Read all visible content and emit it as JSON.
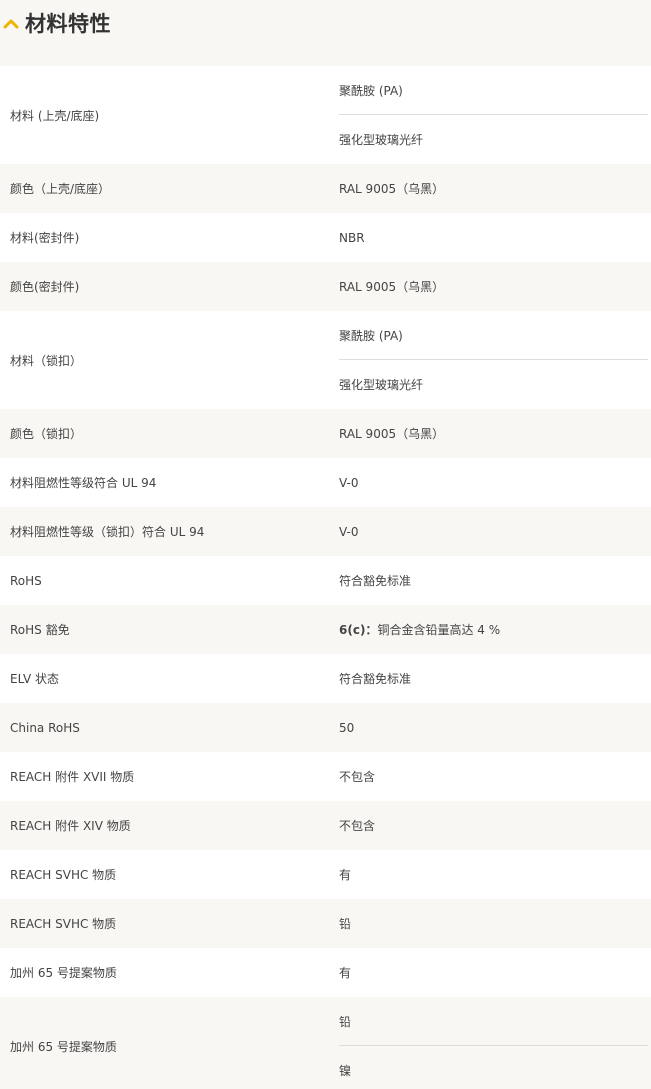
{
  "section": {
    "title": "材料特性",
    "toggle_icon": "chevron-up-icon",
    "accent_color": "#f0b400"
  },
  "rows": [
    {
      "label": "材料 (上壳/底座)",
      "values": [
        "聚酰胺 (PA)",
        "强化型玻璃光纤"
      ]
    },
    {
      "label": "颜色（上壳/底座）",
      "values": [
        "RAL 9005（乌黑）"
      ]
    },
    {
      "label": "材料(密封件)",
      "values": [
        "NBR"
      ]
    },
    {
      "label": "颜色(密封件)",
      "values": [
        "RAL 9005（乌黑）"
      ]
    },
    {
      "label": "材料（锁扣）",
      "values": [
        "聚酰胺 (PA)",
        "强化型玻璃光纤"
      ]
    },
    {
      "label": "颜色（锁扣）",
      "values": [
        "RAL 9005（乌黑）"
      ]
    },
    {
      "label": "材料阻燃性等级符合 UL 94",
      "values": [
        "V-0"
      ]
    },
    {
      "label": "材料阻燃性等级（锁扣）符合 UL 94",
      "values": [
        "V-0"
      ]
    },
    {
      "label": "RoHS",
      "values": [
        "符合豁免标准"
      ]
    },
    {
      "label": "RoHS 豁免",
      "values": [],
      "rich_value": {
        "bold": "6(c)：",
        "rest": "铜合金含铅量高达 4 %"
      }
    },
    {
      "label": "ELV 状态",
      "values": [
        "符合豁免标准"
      ]
    },
    {
      "label": "China RoHS",
      "values": [
        "50"
      ]
    },
    {
      "label": "REACH 附件 XVII 物质",
      "values": [
        "不包含"
      ]
    },
    {
      "label": "REACH 附件 XIV 物质",
      "values": [
        "不包含"
      ]
    },
    {
      "label": "REACH SVHC 物质",
      "values": [
        "有"
      ]
    },
    {
      "label": "REACH SVHC 物质",
      "values": [
        "铅"
      ]
    },
    {
      "label": "加州 65 号提案物质",
      "values": [
        "有"
      ]
    },
    {
      "label": "加州 65 号提案物质",
      "values": [
        "铅",
        "镍"
      ]
    }
  ]
}
